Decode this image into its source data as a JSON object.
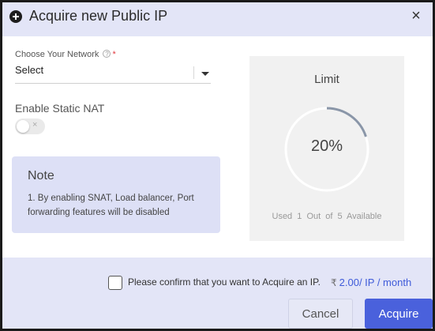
{
  "dialog": {
    "title": "Acquire new Public IP",
    "close_glyph": "×",
    "header_icon": "plus-circle-icon"
  },
  "network": {
    "label": "Choose Your Network",
    "help_glyph": "?",
    "required_mark": "*",
    "selected": "Select"
  },
  "snat": {
    "label": "Enable Static NAT",
    "enabled": false,
    "off_glyph": "×"
  },
  "note": {
    "title": "Note",
    "text": "1. By enabling SNAT, Load balancer, Port forwarding features will be disabled"
  },
  "limit": {
    "title": "Limit",
    "percent": 20,
    "percent_text": "20%",
    "used_label": "Used",
    "used": "1",
    "out_of_label": "Out of",
    "total": "5",
    "available_label": "Available"
  },
  "footer": {
    "confirm_text": "Please confirm that you want to Acquire an IP.",
    "confirmed": false,
    "currency_symbol": "₹",
    "price": "2.00/ IP / month",
    "cancel_label": "Cancel",
    "acquire_label": "Acquire"
  },
  "colors": {
    "header_bg": "#e3e5f7",
    "note_bg": "#dde0f6",
    "accent": "#4a61dc",
    "price_text": "#3f5bd9",
    "ring_progress": "#8a96a8",
    "ring_track": "#ffffff"
  }
}
